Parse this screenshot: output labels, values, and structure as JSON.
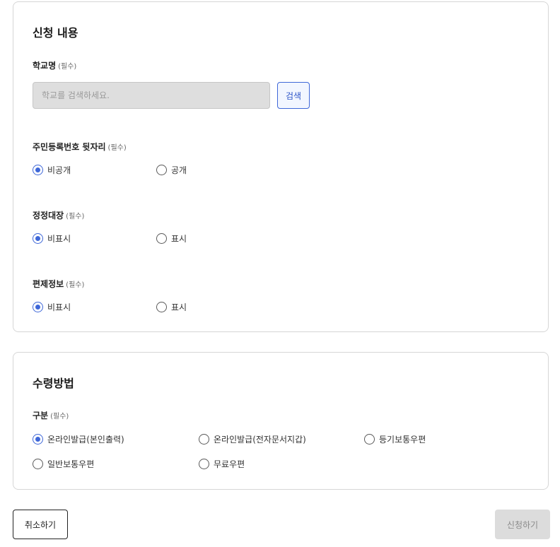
{
  "application": {
    "title": "신청 내용",
    "school": {
      "label": "학교명",
      "required": "(필수)",
      "input_placeholder": "학교를 검색하세요.",
      "input_value": "",
      "search_label": "검색"
    },
    "resident_number": {
      "label": "주민등록번호 뒷자리",
      "required": "(필수)",
      "options": [
        {
          "label": "비공개",
          "checked": true
        },
        {
          "label": "공개",
          "checked": false
        }
      ]
    },
    "correction_ledger": {
      "label": "정정대장",
      "required": "(필수)",
      "options": [
        {
          "label": "비표시",
          "checked": true
        },
        {
          "label": "표시",
          "checked": false
        }
      ]
    },
    "compilation_info": {
      "label": "편제정보",
      "required": "(필수)",
      "options": [
        {
          "label": "비표시",
          "checked": true
        },
        {
          "label": "표시",
          "checked": false
        }
      ]
    }
  },
  "receipt": {
    "title": "수령방법",
    "category": {
      "label": "구분",
      "required": "(필수)",
      "options": [
        {
          "label": "온라인발급(본인출력)",
          "checked": true
        },
        {
          "label": "온라인발급(전자문서지갑)",
          "checked": false
        },
        {
          "label": "등기보통우편",
          "checked": false
        },
        {
          "label": "일반보통우편",
          "checked": false
        },
        {
          "label": "무료우편",
          "checked": false
        }
      ]
    }
  },
  "actions": {
    "cancel_label": "취소하기",
    "submit_label": "신청하기",
    "submit_enabled": false
  },
  "colors": {
    "accent": "#3e67d8",
    "border": "#d6d6d6",
    "disabled_bg": "#dcdcdc"
  }
}
